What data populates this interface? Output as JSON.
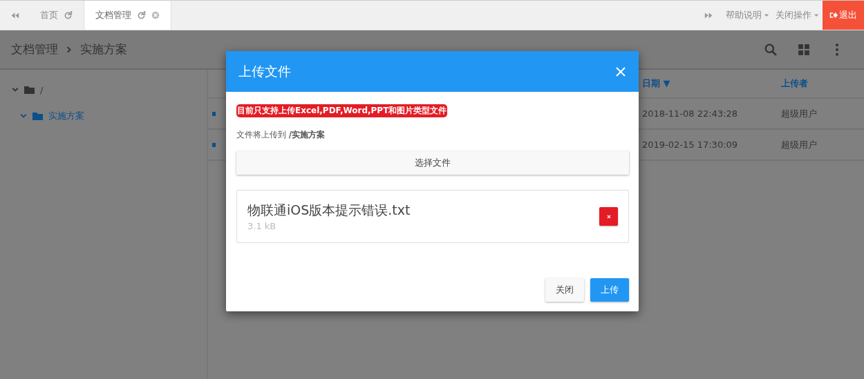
{
  "topbar": {
    "tabs": [
      {
        "label": "首页",
        "selected": false,
        "closable": false
      },
      {
        "label": "文档管理",
        "selected": true,
        "closable": true
      }
    ],
    "menus": [
      "帮助说明",
      "关闭操作"
    ],
    "logout": "退出"
  },
  "breadcrumb": [
    "文档管理",
    "实施方案"
  ],
  "tree": [
    {
      "label": "/",
      "expanded": true,
      "selected": false,
      "children": [
        {
          "label": "实施方案",
          "expanded": true,
          "selected": true
        }
      ]
    }
  ],
  "table": {
    "columns": [
      "日期 ▼",
      "上传者"
    ],
    "rows": [
      [
        "2018-11-08 22:43:28",
        "超级用户"
      ],
      [
        "2019-02-15 17:30:09",
        "超级用户"
      ]
    ]
  },
  "dialog": {
    "title": "上传文件",
    "notice": "目前只支持上传Excel,PDF,Word,PPT和图片类型文件",
    "target": "文件将上传到 **/实施方案**",
    "choose": "选择文件",
    "files": [
      {
        "name": "物联通iOS版本提示错误.txt",
        "size": "3.1 kB"
      }
    ],
    "buttons": [
      {
        "label": "关闭",
        "kind": "default"
      },
      {
        "label": "上传",
        "kind": "primary"
      }
    ]
  }
}
